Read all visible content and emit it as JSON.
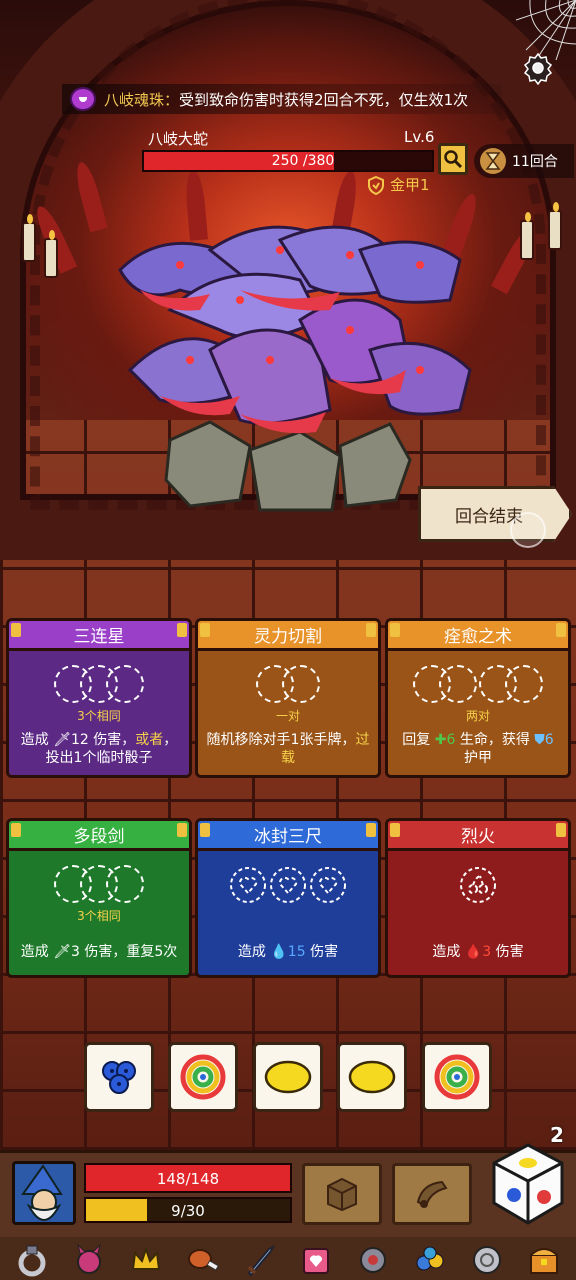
{
  "relic": {
    "name": "八岐魂珠",
    "colon": "：",
    "effect": "受到致命伤害时获得2回合不死，仅生效1次"
  },
  "enemy": {
    "name": "八岐大蛇",
    "level": "Lv.6",
    "hp_text": "250 /380",
    "hp_fraction": 0.658,
    "armor": "金甲1"
  },
  "round": {
    "label": "11回合"
  },
  "end_turn_button": "回合结束",
  "cards": [
    {
      "title": "三连星",
      "color": "purple",
      "slot_note": "3个相同",
      "desc_parts": [
        "造成 ",
        "12 伤害，",
        "或者",
        "，投出1个临时骰子"
      ]
    },
    {
      "title": "灵力切割",
      "color": "orange",
      "slot_note": "一对",
      "desc_parts": [
        "随机移除对手1张手牌，",
        "过载"
      ]
    },
    {
      "title": "痊愈之术",
      "color": "orange",
      "slot_note": "两对",
      "desc_parts": [
        "回复 ",
        "6",
        " 生命，获得 ",
        "6",
        " 护甲"
      ]
    },
    {
      "title": "多段剑",
      "color": "green",
      "slot_note": "3个相同",
      "desc_parts": [
        "造成 ",
        "3 伤害，重复5次"
      ]
    },
    {
      "title": "冰封三尺",
      "color": "blue",
      "slot_note": "",
      "desc_parts": [
        "造成 ",
        "15",
        " 伤害"
      ]
    },
    {
      "title": "烈火",
      "color": "red",
      "slot_note": "",
      "desc_parts": [
        "造成 ",
        "3",
        " 伤害"
      ]
    }
  ],
  "dice": [
    {
      "icon": "blueberry-icon"
    },
    {
      "icon": "rainbow-swirl-icon"
    },
    {
      "icon": "lemon-icon"
    },
    {
      "icon": "lemon-icon"
    },
    {
      "icon": "rainbow-swirl-icon"
    }
  ],
  "player": {
    "hp_text": "148/148",
    "hp_fraction": 1.0,
    "mp_text": "9/30",
    "mp_fraction": 0.3,
    "reroll_count": "2"
  },
  "relics_bar": [
    "ring-icon",
    "demon-icon",
    "crown-icon",
    "meat-icon",
    "sword-icon",
    "love-potion-icon",
    "gauntlet-icon",
    "berries-icon",
    "coin-icon",
    "treasure-chest-icon"
  ],
  "colors": {
    "hp_red": "#e0262a",
    "mp_yellow": "#f0c020",
    "keyword_yellow": "#f6d24a"
  }
}
